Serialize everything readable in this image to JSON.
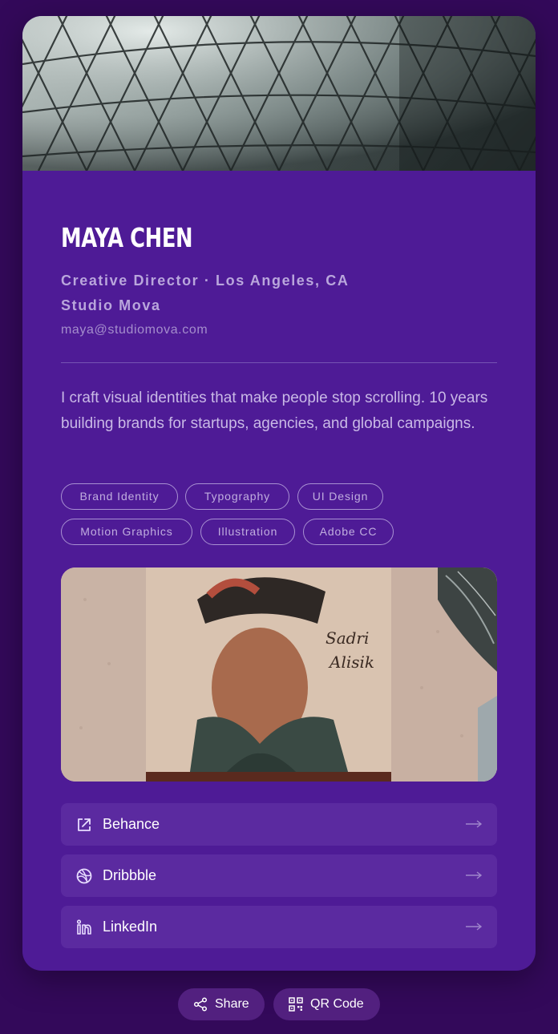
{
  "profile": {
    "name": "MAYA CHEN",
    "role_line": "Creative Director · Los Angeles, CA",
    "company": "Studio Mova",
    "email": "maya@studiomova.com",
    "bio": "I craft visual identities that make people stop scrolling. 10 years building brands for startups, agencies, and global campaigns."
  },
  "tags": [
    "Brand Identity",
    "Typography",
    "UI Design",
    "Motion Graphics",
    "Illustration",
    "Adobe CC"
  ],
  "links": [
    {
      "label": "Behance",
      "icon": "external-link-icon"
    },
    {
      "label": "Dribbble",
      "icon": "dribbble-icon"
    },
    {
      "label": "LinkedIn",
      "icon": "linkedin-icon"
    }
  ],
  "footer": {
    "share_label": "Share",
    "qr_label": "QR Code"
  },
  "artwork": {
    "signature_line1": "Sadri",
    "signature_line2": "Alisik"
  },
  "colors": {
    "background": "#33095a",
    "card": "#4e1b96",
    "link_row": "#5b2aa0",
    "accent_text": "#b9a6dc"
  }
}
